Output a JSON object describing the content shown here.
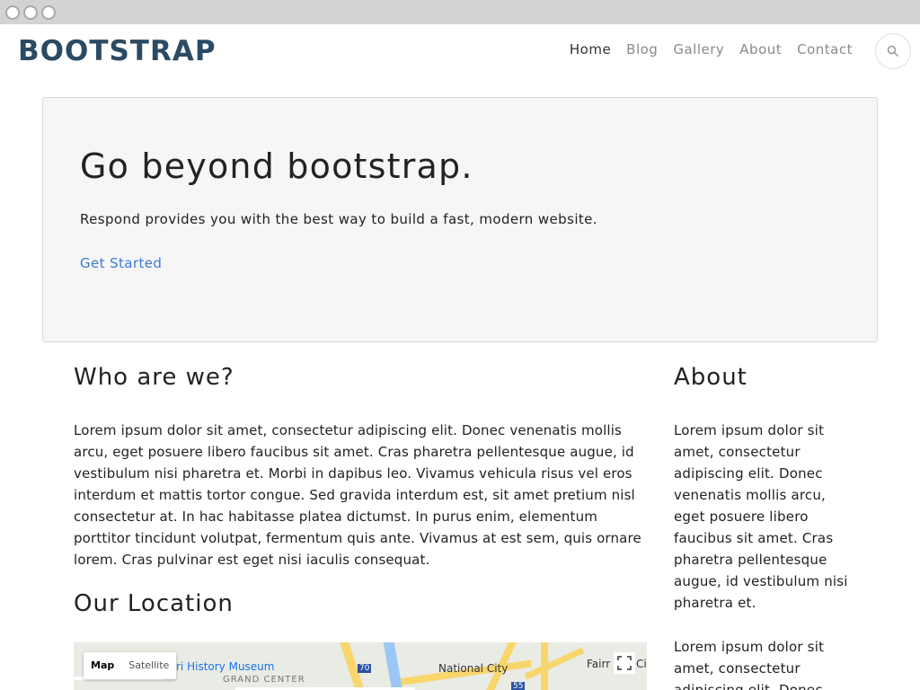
{
  "brand": "BOOTSTRAP",
  "nav": {
    "items": [
      {
        "label": "Home"
      },
      {
        "label": "Blog"
      },
      {
        "label": "Gallery"
      },
      {
        "label": "About"
      },
      {
        "label": "Contact"
      }
    ],
    "active": "Home",
    "search_icon": "search-icon"
  },
  "hero": {
    "title": "Go beyond bootstrap.",
    "text": "Respond provides you with the best way to build a fast, modern website.",
    "cta": "Get Started"
  },
  "main": {
    "who_title": "Who are we?",
    "who_text": "Lorem ipsum dolor sit amet, consectetur adipiscing elit. Donec venenatis mollis arcu, eget posuere libero faucibus sit amet. Cras pharetra pellentesque augue, id vestibulum nisi pharetra et. Morbi in dapibus leo. Vivamus vehicula risus vel eros interdum et mattis tortor congue. Sed gravida interdum est, sit amet pretium nisl consectetur at. In hac habitasse platea dictumst. In purus enim, elementum porttitor tincidunt volutpat, fermentum quis ante. Vivamus at est sem, quis ornare lorem. Cras pulvinar est eget nisi iaculis consequat.",
    "location_title": "Our Location"
  },
  "map": {
    "type_map": "Map",
    "type_satellite": "Satellite",
    "label_museum": "ri History Museum",
    "label_center": "GRAND CENTER",
    "label_city": "National City",
    "label_fair": "Fairr",
    "label_ci": "Ci",
    "shield_70": "70",
    "shield_55": "55"
  },
  "sidebar": {
    "title": "About",
    "text1": "Lorem ipsum dolor sit amet, consectetur adipiscing elit. Donec venenatis mollis arcu, eget posuere libero faucibus sit amet. Cras pharetra pellentesque augue, id vestibulum nisi pharetra et.",
    "text2": "Lorem ipsum dolor sit amet, consectetur adipiscing elit. Donec"
  },
  "colors": {
    "brand": "#2b4a63",
    "link": "#3a7bd5",
    "hero_bg": "#f6f6f6"
  }
}
